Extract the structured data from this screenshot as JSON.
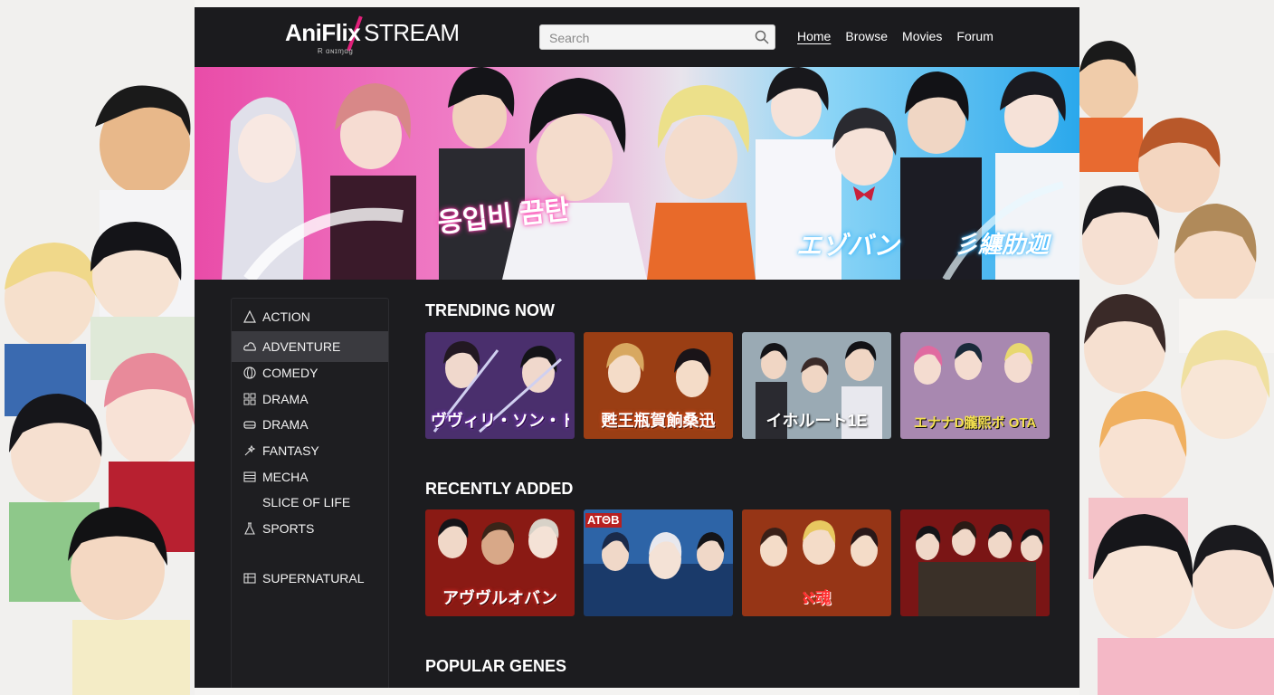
{
  "app": {
    "logo_main": "AniFlix",
    "logo_stream": "STREAM",
    "logo_sub": "Ɍ ɑɴɪɱɑɡ"
  },
  "search": {
    "placeholder": "Search",
    "value": ""
  },
  "nav": {
    "items": [
      {
        "label": "Home",
        "active": true
      },
      {
        "label": "Browse",
        "active": false
      },
      {
        "label": "Movies",
        "active": false
      },
      {
        "label": "Forum",
        "active": false
      }
    ]
  },
  "hero": {
    "text_left": "응입비 끔탄",
    "text_mid": "エゾバン",
    "text_right": "彡纏肋迦"
  },
  "sidebar": {
    "genres": [
      {
        "label": "ACTION",
        "icon": "triangle-icon"
      },
      {
        "label": "ADVENTURE",
        "icon": "cloud-icon",
        "selected": true
      },
      {
        "label": "COMEDY",
        "icon": "globe-icon"
      },
      {
        "label": "DRAMA",
        "icon": "grid-icon"
      },
      {
        "label": "DRAMA",
        "icon": "car-icon"
      },
      {
        "label": "FANTASY",
        "icon": "wand-icon"
      },
      {
        "label": "MECHA",
        "icon": "list-icon"
      },
      {
        "label": "SLICE OF LIFE",
        "icon": ""
      },
      {
        "label": "SPORTS",
        "icon": "flask-icon"
      },
      {
        "label": "SUPERNATURAL",
        "icon": "table-icon"
      }
    ]
  },
  "sections": {
    "trending": {
      "title": "TRENDING NOW",
      "cards": [
        {
          "title": "ヴヴィリ・ソン・ド",
          "accent": "#6a3ab0"
        },
        {
          "title": "甦王瓶賀餉桑迅",
          "accent": "#c93a1a"
        },
        {
          "title": "イホルート1E",
          "accent": "#5a6e7a"
        },
        {
          "title": "エナナD朧熙ボ OTA",
          "accent": "#c8a030"
        }
      ]
    },
    "recent": {
      "title": "RECENTLY ADDED",
      "cards": [
        {
          "title": "アヴヴルオバン",
          "accent": "#b8281c"
        },
        {
          "title": "ΑΤΘΒ",
          "accent": "#2a70c0"
        },
        {
          "title": "ℵ魂",
          "accent": "#c24a1c"
        },
        {
          "title": "",
          "accent": "#9a1a1a"
        }
      ]
    },
    "popular": {
      "title": "POPULAR GENES"
    }
  },
  "colors": {
    "accent_pink": "#e0207a",
    "accent_blue": "#1aa8ff",
    "window_bg": "#1c1c1f",
    "selected_genre": "#3a3a3f"
  }
}
